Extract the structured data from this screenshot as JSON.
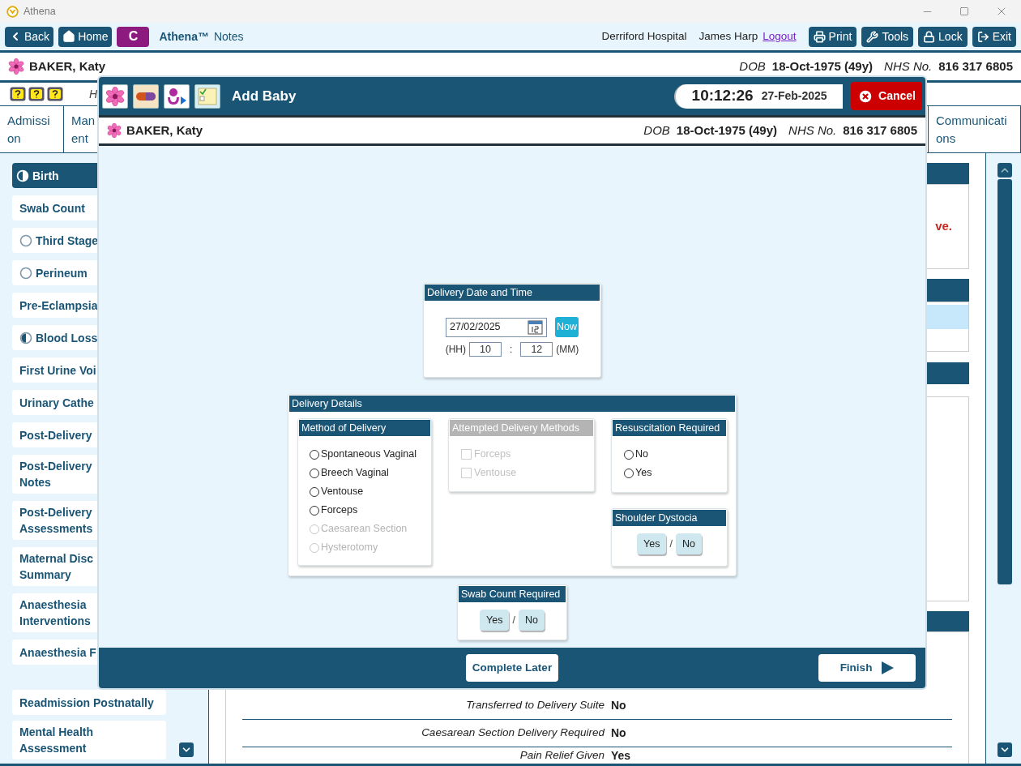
{
  "window": {
    "title": "Athena"
  },
  "toolbar": {
    "nav_buttons": [
      {
        "kind": "back",
        "label": "Back"
      },
      {
        "kind": "home",
        "label": "Home"
      }
    ],
    "app_badge": "C",
    "app_name": "Athena™",
    "app_suffix": "Notes",
    "hospital": "Derriford Hospital",
    "user": "James Harp",
    "logout": "Logout",
    "action_buttons": [
      {
        "kind": "print",
        "label": "Print"
      },
      {
        "kind": "tools",
        "label": "Tools"
      },
      {
        "kind": "lock",
        "label": "Lock"
      },
      {
        "kind": "exit",
        "label": "Exit"
      }
    ]
  },
  "patient": {
    "name": "BAKER, Katy",
    "dob_label": "DOB",
    "dob": "18-Oct-1975 (49y)",
    "nhs_label": "NHS No.",
    "nhs": "816 317 6805"
  },
  "info_row": {
    "text": "H"
  },
  "tabs": [
    {
      "lines": [
        "Admissi",
        "on"
      ]
    },
    {
      "lines": [
        "Man",
        "ent"
      ]
    },
    {
      "lines": [
        "Communicati",
        "ons"
      ]
    }
  ],
  "sidebar": {
    "items": [
      {
        "lines": [
          "Birth"
        ],
        "kind": "half",
        "selected": true
      },
      {
        "lines": [
          "Swab Count"
        ],
        "kind": "plain",
        "selected": false
      },
      {
        "lines": [
          "Third Stage"
        ],
        "kind": "empty",
        "selected": false
      },
      {
        "lines": [
          "Perineum"
        ],
        "kind": "empty",
        "selected": false
      },
      {
        "lines": [
          "Pre-Eclampsia"
        ],
        "kind": "plain",
        "selected": false
      },
      {
        "lines": [
          "Blood Loss"
        ],
        "kind": "half",
        "selected": false
      },
      {
        "lines": [
          "First Urine Voi"
        ],
        "kind": "plain",
        "selected": false
      },
      {
        "lines": [
          "Urinary Cathe"
        ],
        "kind": "plain",
        "selected": false
      },
      {
        "lines": [
          "Post-Delivery"
        ],
        "kind": "plain",
        "selected": false
      },
      {
        "lines": [
          "Post-Delivery",
          "Notes"
        ],
        "kind": "plain",
        "selected": false
      },
      {
        "lines": [
          "Post-Delivery",
          "Assessments"
        ],
        "kind": "plain",
        "selected": false
      },
      {
        "lines": [
          "Maternal Disc",
          "Summary"
        ],
        "kind": "plain",
        "selected": false
      },
      {
        "lines": [
          "Anaesthesia",
          "Interventions"
        ],
        "kind": "plain",
        "selected": false
      },
      {
        "lines": [
          "Anaesthesia F"
        ],
        "kind": "plain",
        "selected": false
      }
    ],
    "lower_items": [
      {
        "lines": [
          "Readmission Postnatally"
        ],
        "selected": false
      },
      {
        "lines": [
          "Mental Health",
          "Assessment"
        ],
        "selected": false
      }
    ]
  },
  "content": {
    "warning_text": "ve.",
    "rows": [
      {
        "label": "Transferred to Delivery Suite",
        "value": "No"
      },
      {
        "label": "Caesarean Section Delivery Required",
        "value": "No"
      },
      {
        "label": "Pain Relief Given",
        "value": "Yes"
      }
    ]
  },
  "modal": {
    "title": "Add Baby",
    "time": "10:12:26",
    "date": "27-Feb-2025",
    "cancel": "Cancel",
    "patient": {
      "name": "BAKER, Katy",
      "dob_label": "DOB",
      "dob": "18-Oct-1975 (49y)",
      "nhs_label": "NHS No.",
      "nhs": "816 317 6805"
    },
    "datetime": {
      "title": "Delivery Date and Time",
      "date": "27/02/2025",
      "now": "Now",
      "hh_label": "(HH)",
      "hh": "10",
      "separator": ":",
      "mm": "12",
      "mm_label": "(MM)"
    },
    "details": {
      "title": "Delivery Details",
      "method": {
        "title": "Method of Delivery",
        "options": [
          {
            "label": "Spontaneous Vaginal",
            "selected": false,
            "disabled": false
          },
          {
            "label": "Breech Vaginal",
            "selected": false,
            "disabled": false
          },
          {
            "label": "Ventouse",
            "selected": false,
            "disabled": false
          },
          {
            "label": "Forceps",
            "selected": false,
            "disabled": false
          },
          {
            "label": "Caesarean Section",
            "selected": false,
            "disabled": true
          },
          {
            "label": "Hysterotomy",
            "selected": false,
            "disabled": true
          }
        ]
      },
      "attempted": {
        "title": "Attempted Delivery Methods",
        "disabled": true,
        "options": [
          {
            "label": "Forceps",
            "checked": false
          },
          {
            "label": "Ventouse",
            "checked": false
          }
        ]
      },
      "resuscitation": {
        "title": "Resuscitation Required",
        "options": [
          {
            "label": "No",
            "selected": false
          },
          {
            "label": "Yes",
            "selected": false
          }
        ]
      },
      "shoulder": {
        "title": "Shoulder Dystocia",
        "buttons": [
          {
            "label": "Yes",
            "selected": false
          },
          {
            "label": "No",
            "selected": false
          }
        ],
        "separator": "/"
      }
    },
    "swab": {
      "title": "Swab Count Required",
      "buttons": [
        {
          "label": "Yes",
          "selected": false
        },
        {
          "label": "No",
          "selected": false
        }
      ],
      "separator": "/"
    },
    "complete_later": "Complete Later",
    "finish": "Finish"
  }
}
